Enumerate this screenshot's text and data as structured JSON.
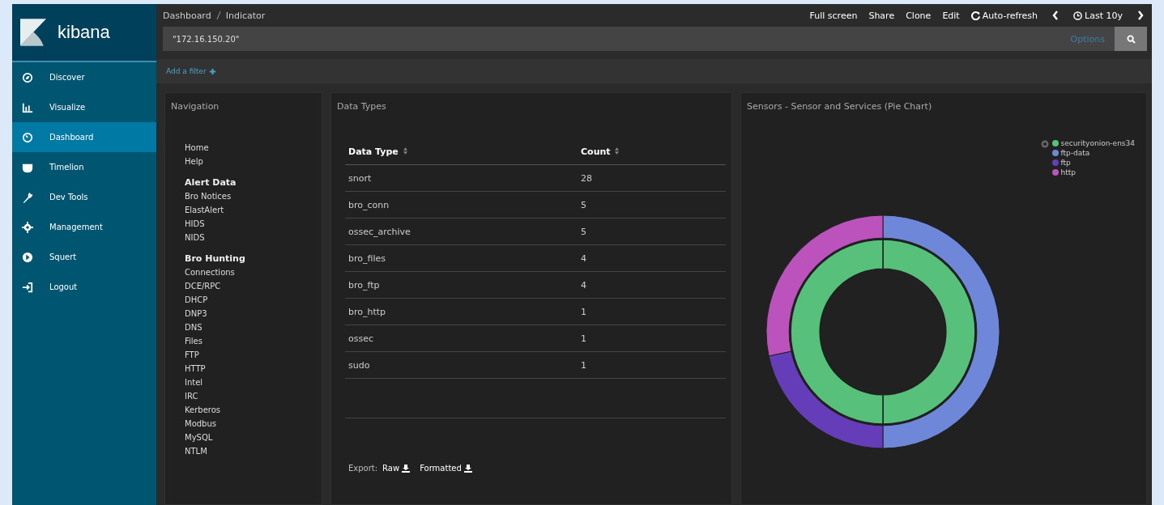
{
  "sidebar": {
    "logo": "kibana",
    "items": [
      {
        "label": "Discover",
        "selected": false
      },
      {
        "label": "Visualize",
        "selected": false
      },
      {
        "label": "Dashboard",
        "selected": true
      },
      {
        "label": "Timelion",
        "selected": false
      },
      {
        "label": "Dev Tools",
        "selected": false
      },
      {
        "label": "Management",
        "selected": false
      },
      {
        "label": "Squert",
        "selected": false
      },
      {
        "label": "Logout",
        "selected": false
      }
    ]
  },
  "breadcrumbs": [
    "Dashboard",
    "Indicator"
  ],
  "top_menu": [
    {
      "label": "Full screen",
      "kind": "plain"
    },
    {
      "label": "Share",
      "kind": "plain"
    },
    {
      "label": "Clone",
      "kind": "plain"
    },
    {
      "label": "Edit",
      "kind": "plain"
    },
    {
      "label": "Auto-refresh",
      "kind": "refresh"
    }
  ],
  "time_picker": {
    "label": "Last 10y"
  },
  "query": {
    "value": "\"172.16.150.20\"",
    "options_link": "Options"
  },
  "add_filter": "Add a filter",
  "panels": {
    "navigation": {
      "title": "Navigation",
      "groups": [
        {
          "items": [
            "Home",
            "Help"
          ]
        },
        {
          "heading": "Alert Data",
          "items": [
            "Bro Notices",
            "ElastAlert",
            "HIDS",
            "NIDS"
          ]
        },
        {
          "heading": "Bro Hunting",
          "items": [
            "Connections",
            "DCE/RPC",
            "DHCP",
            "DNP3",
            "DNS",
            "Files",
            "FTP",
            "HTTP",
            "Intel",
            "IRC",
            "Kerberos",
            "Modbus",
            "MySQL",
            "NTLM"
          ]
        }
      ]
    },
    "data_types": {
      "title": "Data Types",
      "columns": [
        "Data Type",
        "Count"
      ],
      "rows": [
        [
          "snort",
          "28"
        ],
        [
          "bro_conn",
          "5"
        ],
        [
          "ossec_archive",
          "5"
        ],
        [
          "bro_files",
          "4"
        ],
        [
          "bro_ftp",
          "4"
        ],
        [
          "bro_http",
          "1"
        ],
        [
          "ossec",
          "1"
        ],
        [
          "sudo",
          "1"
        ]
      ],
      "export_label": "Export:",
      "export_links": [
        "Raw",
        "Formatted"
      ]
    },
    "sensors": {
      "title": "Sensors - Sensor and Services (Pie Chart)",
      "legend": [
        {
          "label": "securityonion-ens34",
          "color": "#57c17b"
        },
        {
          "label": "ftp-data",
          "color": "#6f87d8"
        },
        {
          "label": "ftp",
          "color": "#663db8"
        },
        {
          "label": "http",
          "color": "#bc52bc"
        }
      ]
    }
  }
}
